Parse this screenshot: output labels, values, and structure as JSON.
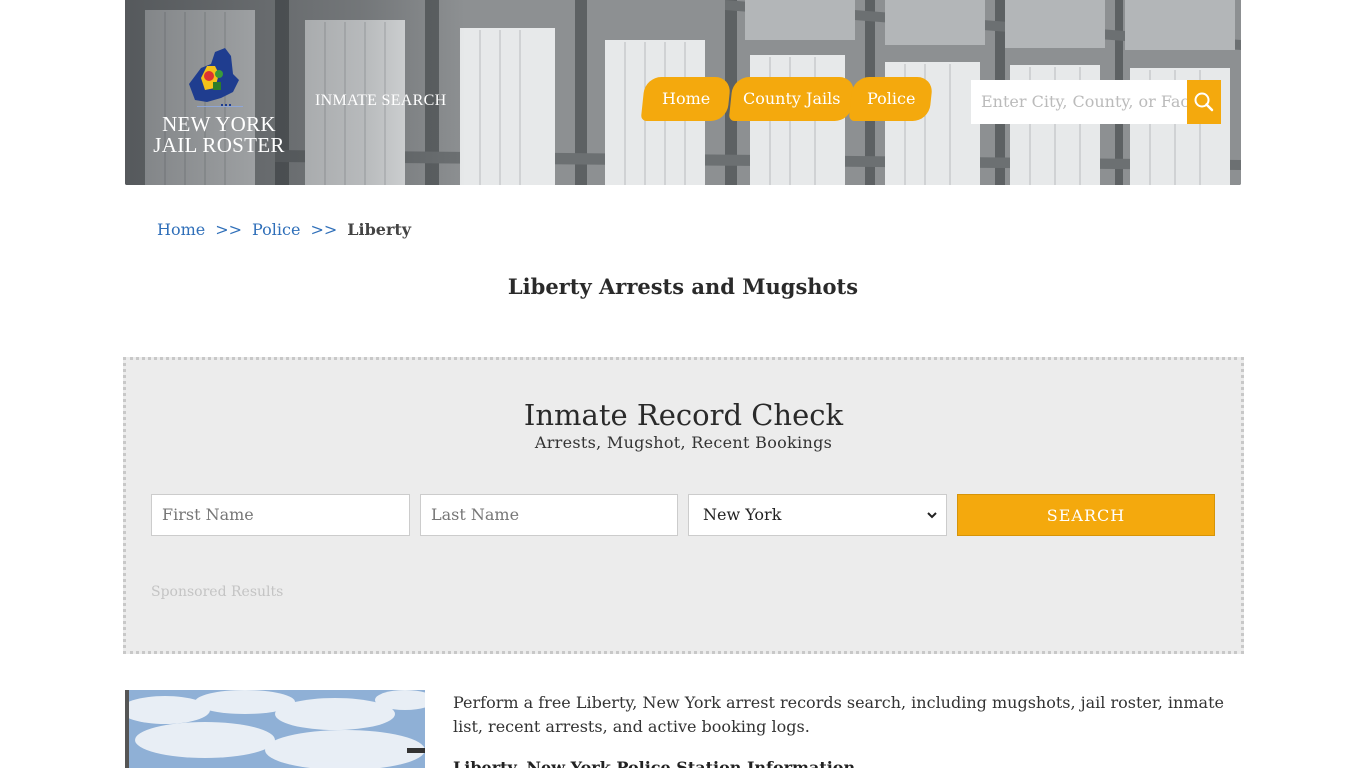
{
  "header": {
    "logo_line1": "NEW YORK",
    "logo_line2": "JAIL ROSTER",
    "inmate_search_label": "INMATE SEARCH",
    "nav": [
      {
        "label": "Home"
      },
      {
        "label": "County Jails"
      },
      {
        "label": "Police"
      }
    ],
    "search_placeholder": "Enter City, County, or Facil",
    "accent_color": "#f4a90d"
  },
  "breadcrumb": {
    "items": [
      "Home",
      "Police"
    ],
    "separator": ">>",
    "current": "Liberty"
  },
  "page_title": "Liberty Arrests and Mugshots",
  "record_check": {
    "title": "Inmate Record Check",
    "subtitle": "Arrests, Mugshot, Recent Bookings",
    "first_name_placeholder": "First Name",
    "last_name_placeholder": "Last Name",
    "state_selected": "New York",
    "search_label": "SEARCH",
    "sponsored_label": "Sponsored Results"
  },
  "content": {
    "intro": "Perform a free Liberty, New York arrest records search, including mugshots, jail roster, inmate list, recent arrests, and active booking logs.",
    "info_heading": "Liberty, New York Police Station Information"
  }
}
